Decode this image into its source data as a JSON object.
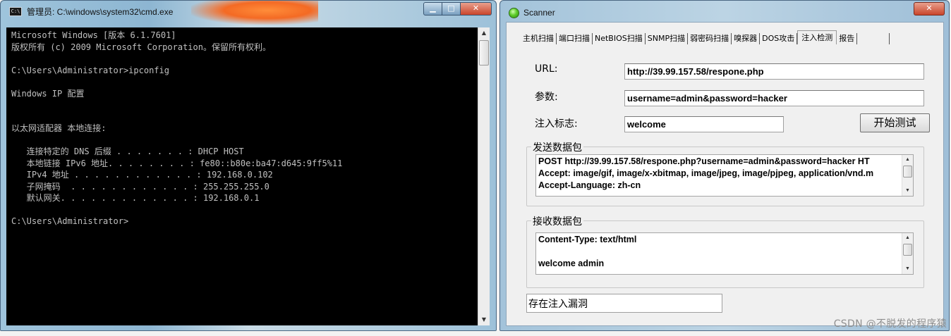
{
  "cmd": {
    "title": "管理员: C:\\windows\\system32\\cmd.exe",
    "icon_label": "C:\\",
    "buttons": {
      "minimize": "▁",
      "maximize": "□",
      "close": "✕"
    },
    "lines": [
      "Microsoft Windows [版本 6.1.7601]",
      "版权所有 (c) 2009 Microsoft Corporation。保留所有权利。",
      "",
      "C:\\Users\\Administrator>ipconfig",
      "",
      "Windows IP 配置",
      "",
      "",
      "以太网适配器 本地连接:",
      "",
      "   连接特定的 DNS 后缀 . . . . . . . : DHCP HOST",
      "   本地链接 IPv6 地址. . . . . . . . : fe80::b80e:ba47:d645:9ff5%11",
      "   IPv4 地址 . . . . . . . . . . . . : 192.168.0.102",
      "   子网掩码  . . . . . . . . . . . . : 255.255.255.0",
      "   默认网关. . . . . . . . . . . . . : 192.168.0.1",
      "",
      "C:\\Users\\Administrator>"
    ]
  },
  "scanner": {
    "title": "Scanner",
    "close": "✕",
    "tabs": [
      "主机扫描",
      "端口扫描",
      "NetBIOS扫描",
      "SNMP扫描",
      "弱密码扫描",
      "嗅探器",
      "DOS攻击",
      "注入检测",
      "报告"
    ],
    "active_tab": "注入检测",
    "url_label": "URL:",
    "url_value": "http://39.99.157.58/respone.php",
    "param_label": "参数:",
    "param_value": "username=admin&password=hacker",
    "flag_label": "注入标志:",
    "flag_value": "welcome",
    "start_button": "开始测试",
    "send_group": "发送数据包",
    "send_lines": [
      "POST http://39.99.157.58/respone.php?username=admin&password=hacker HT",
      "Accept: image/gif, image/x-xbitmap, image/jpeg, image/pjpeg, application/vnd.m",
      "Accept-Language: zh-cn"
    ],
    "recv_group": "接收数据包",
    "recv_lines": [
      "Content-Type: text/html",
      "",
      "welcome admin"
    ],
    "status": "存在注入漏洞"
  },
  "watermark": "CSDN @不脱发的程序猿"
}
